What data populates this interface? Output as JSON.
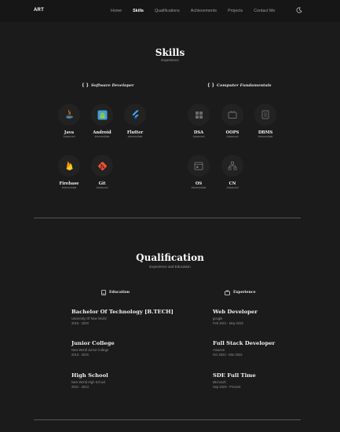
{
  "nav": {
    "logo": "ART",
    "links": [
      "Home",
      "Skills",
      "Qualifications",
      "Achievements",
      "Projects",
      "Contact Me"
    ],
    "active": "Skills",
    "theme_icon": "moon-icon"
  },
  "skills": {
    "title": "Skills",
    "subtitle": "Experience",
    "groups": [
      {
        "braces": "{ }",
        "name": "Software Developer",
        "items": [
          {
            "name": "Java",
            "level": "Advanced",
            "icon": "java-icon"
          },
          {
            "name": "Android",
            "level": "Intermediate",
            "icon": "android-icon"
          },
          {
            "name": "Flutter",
            "level": "Intermediate",
            "icon": "flutter-icon"
          },
          {
            "name": "Firebase",
            "level": "Intermediate",
            "icon": "firebase-icon"
          },
          {
            "name": "Git",
            "level": "Advanced",
            "icon": "git-icon"
          }
        ]
      },
      {
        "braces": "{ }",
        "name": "Computer Fundamentals",
        "items": [
          {
            "name": "DSA",
            "level": "Advanced",
            "icon": "dsa-icon"
          },
          {
            "name": "OOPS",
            "level": "Advanced",
            "icon": "oops-icon"
          },
          {
            "name": "DBMS",
            "level": "Intermediate",
            "icon": "dbms-icon"
          },
          {
            "name": "OS",
            "level": "Intermediate",
            "icon": "os-icon"
          },
          {
            "name": "CN",
            "level": "Advanced",
            "icon": "cn-icon"
          }
        ]
      }
    ],
    "colors": {
      "java": "#e76f00",
      "java_cup": "#5382a1",
      "android_bg": "#3da0d8",
      "android": "#a4c639",
      "flutter": "#42a5f5",
      "flutter_dark": "#0d47a1",
      "firebase": "#ffca28",
      "firebase_dark": "#f57c00",
      "git": "#f05033",
      "icon_gray": "#6a6a6a"
    }
  },
  "qualification": {
    "title": "Qualification",
    "subtitle": "Experience and Education",
    "education_label": "Education",
    "experience_label": "Experience",
    "education": [
      {
        "title": "Bachelor Of Technology [B.TECH]",
        "place": "University Of New World",
        "date": "2015 - 2020"
      },
      {
        "title": "Junior College",
        "place": "New World Junior College",
        "date": "2013 - 2015"
      },
      {
        "title": "High School",
        "place": "New World High School",
        "date": "2001 - 2013"
      }
    ],
    "experience": [
      {
        "title": "Web Developer",
        "place": "google",
        "date": "Feb 2021 - May 2022"
      },
      {
        "title": "Full Stack Developer",
        "place": "Amazon",
        "date": "Oct 2023 - Mar 2022"
      },
      {
        "title": "SDE Full Time",
        "place": "Microsoft",
        "date": "Sep 2023 - Present"
      }
    ]
  }
}
